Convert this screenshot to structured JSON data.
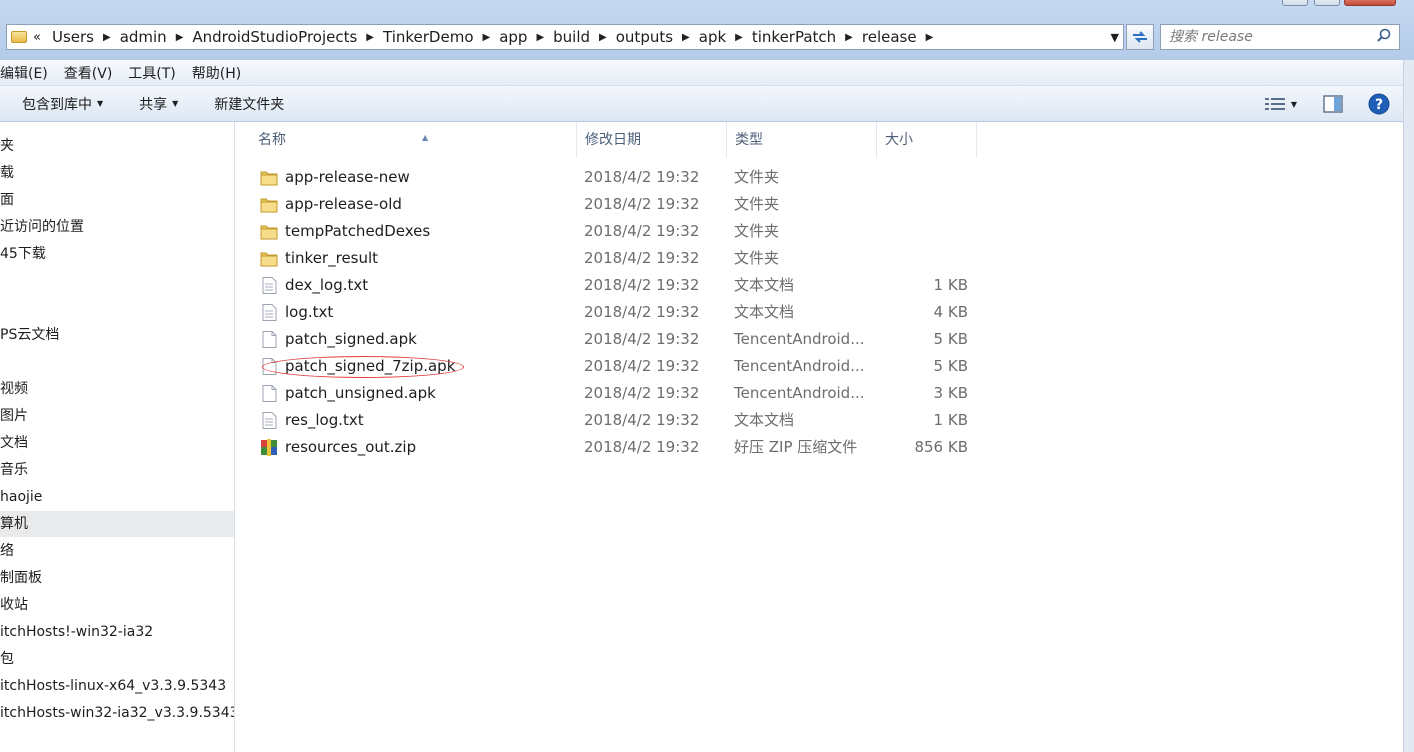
{
  "address": {
    "more_glyph": "«",
    "crumbs": [
      "Users",
      "admin",
      "AndroidStudioProjects",
      "TinkerDemo",
      "app",
      "build",
      "outputs",
      "apk",
      "tinkerPatch",
      "release"
    ]
  },
  "search": {
    "placeholder": "搜索 release"
  },
  "menu": [
    "编辑(E)",
    "查看(V)",
    "工具(T)",
    "帮助(H)"
  ],
  "toolbar": {
    "include_library": "包含到库中",
    "share": "共享",
    "new_folder": "新建文件夹"
  },
  "nav": {
    "items": [
      "夹",
      "载",
      "面",
      "近访问的位置",
      "45下载",
      "PS云文档",
      "视频",
      "图片",
      "文档",
      "音乐",
      "haojie",
      "算机",
      "络",
      "制面板",
      "收站",
      "itchHosts!-win32-ia32",
      "包",
      "itchHosts-linux-x64_v3.3.9.5343",
      "itchHosts-win32-ia32_v3.3.9.5343"
    ],
    "selected": "算机"
  },
  "columns": {
    "name": "名称",
    "date": "修改日期",
    "type": "类型",
    "size": "大小"
  },
  "files": [
    {
      "name": "app-release-new",
      "date": "2018/4/2 19:32",
      "type": "文件夹",
      "size": "",
      "icon": "folder-icon"
    },
    {
      "name": "app-release-old",
      "date": "2018/4/2 19:32",
      "type": "文件夹",
      "size": "",
      "icon": "folder-icon"
    },
    {
      "name": "tempPatchedDexes",
      "date": "2018/4/2 19:32",
      "type": "文件夹",
      "size": "",
      "icon": "folder-icon"
    },
    {
      "name": "tinker_result",
      "date": "2018/4/2 19:32",
      "type": "文件夹",
      "size": "",
      "icon": "folder-icon"
    },
    {
      "name": "dex_log.txt",
      "date": "2018/4/2 19:32",
      "type": "文本文档",
      "size": "1 KB",
      "icon": "text-file-icon"
    },
    {
      "name": "log.txt",
      "date": "2018/4/2 19:32",
      "type": "文本文档",
      "size": "4 KB",
      "icon": "text-file-icon"
    },
    {
      "name": "patch_signed.apk",
      "date": "2018/4/2 19:32",
      "type": "TencentAndroid...",
      "size": "5 KB",
      "icon": "file-icon"
    },
    {
      "name": "patch_signed_7zip.apk",
      "date": "2018/4/2 19:32",
      "type": "TencentAndroid...",
      "size": "5 KB",
      "icon": "file-icon",
      "highlighted": true
    },
    {
      "name": "patch_unsigned.apk",
      "date": "2018/4/2 19:32",
      "type": "TencentAndroid...",
      "size": "3 KB",
      "icon": "file-icon"
    },
    {
      "name": "res_log.txt",
      "date": "2018/4/2 19:32",
      "type": "文本文档",
      "size": "1 KB",
      "icon": "text-file-icon"
    },
    {
      "name": "resources_out.zip",
      "date": "2018/4/2 19:32",
      "type": "好压 ZIP 压缩文件",
      "size": "856 KB",
      "icon": "zip-archive-icon"
    }
  ],
  "colors": {
    "highlight_ring": "#e23a3a",
    "folder": "#e7bc48",
    "header_text": "#4c607a"
  }
}
